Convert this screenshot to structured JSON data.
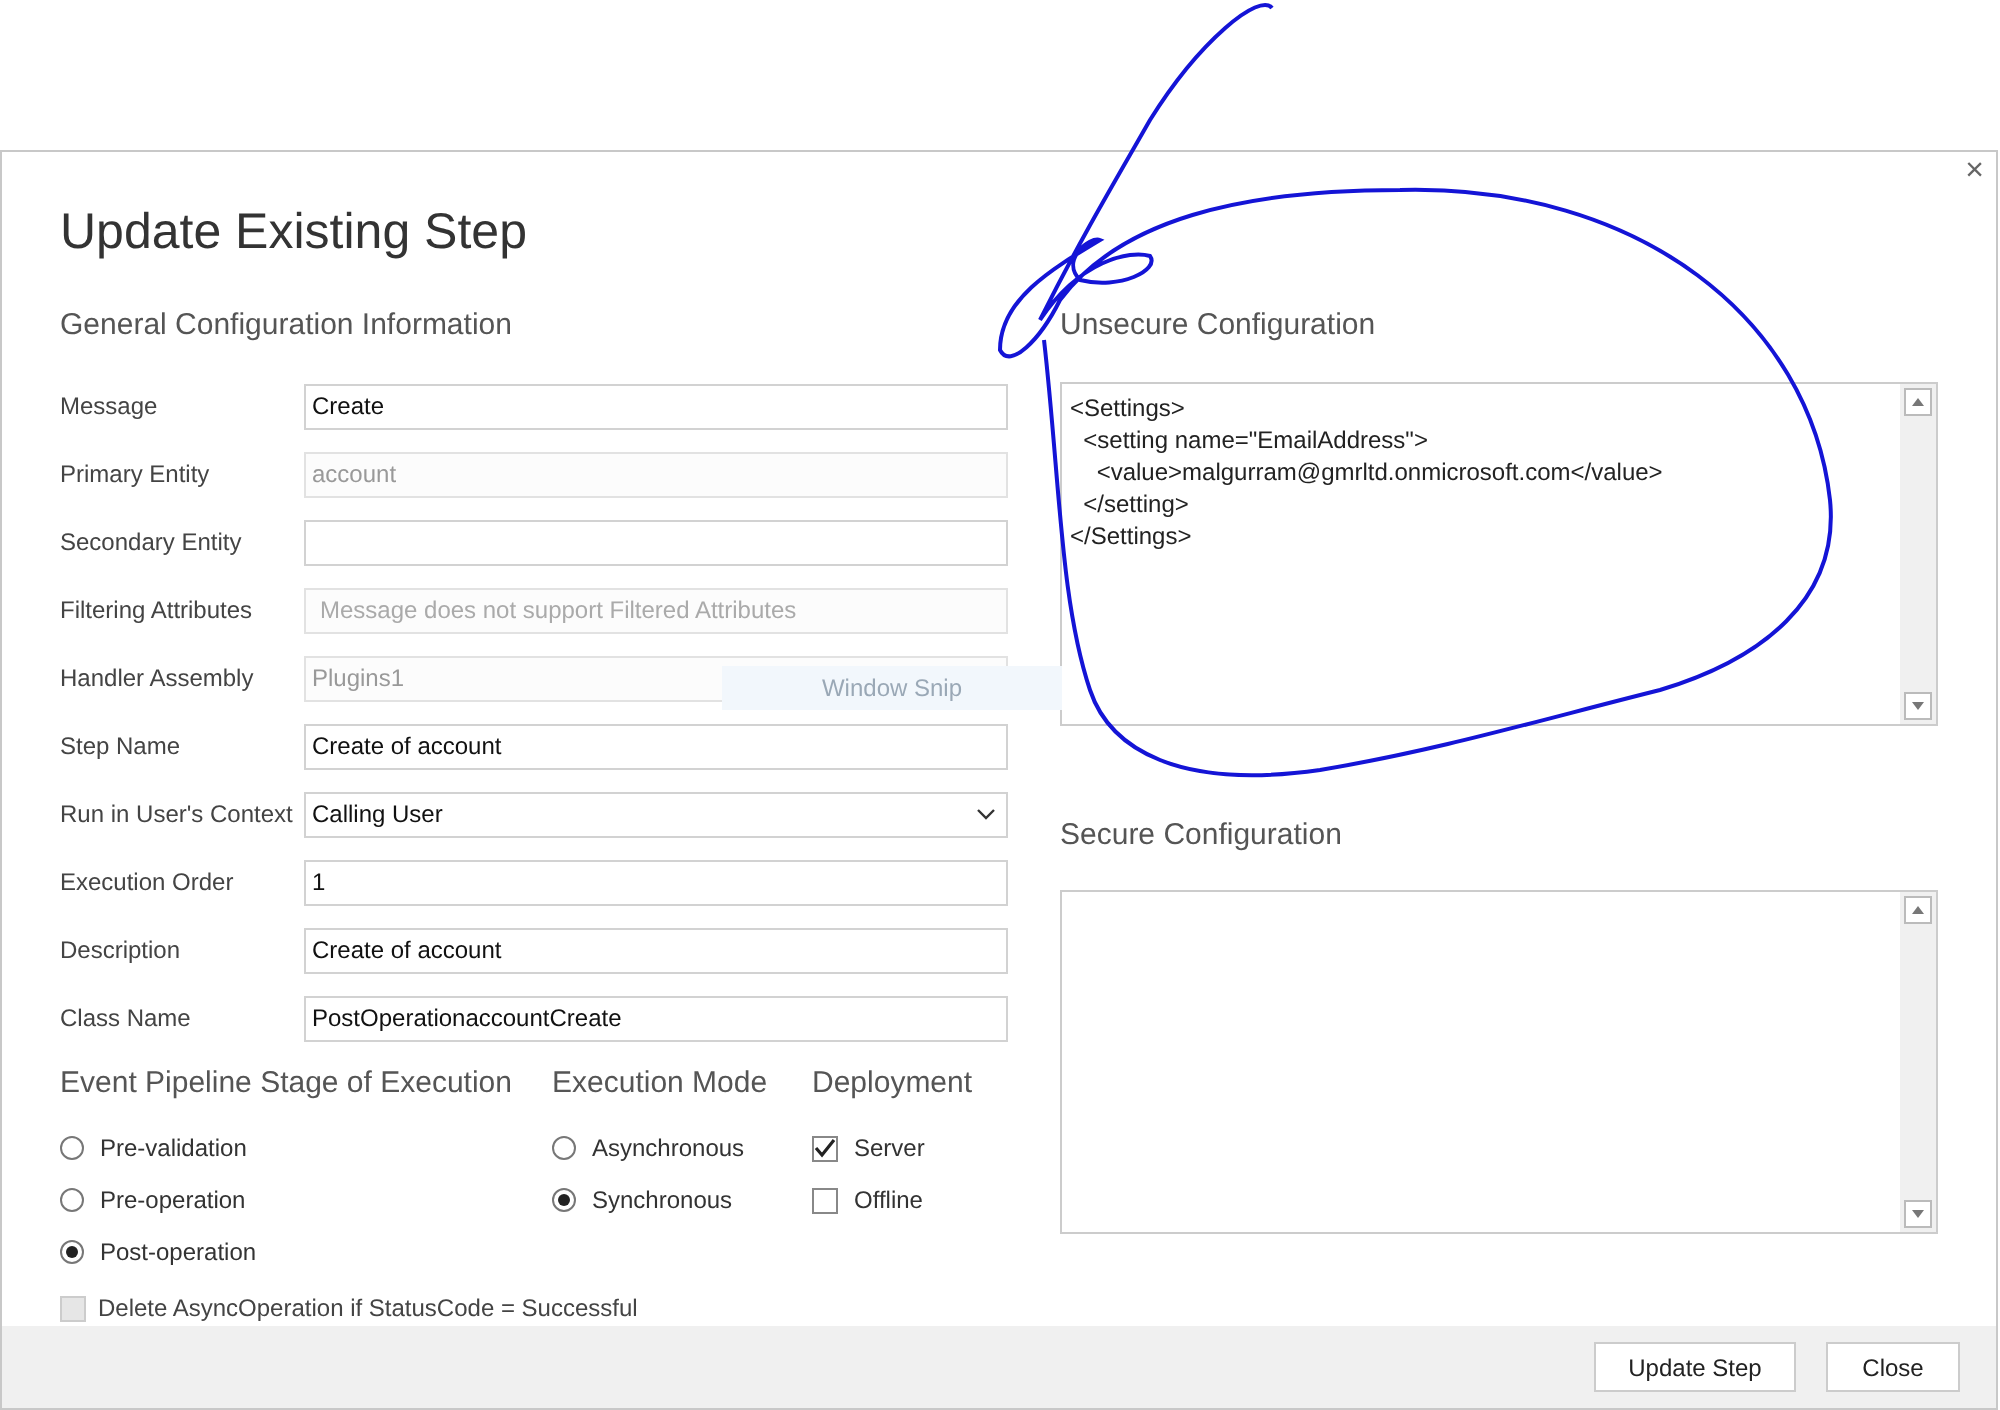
{
  "dialog": {
    "title": "Update Existing Step",
    "close_glyph": "×"
  },
  "general": {
    "heading": "General Configuration Information",
    "fields": [
      {
        "label": "Message",
        "kind": "input",
        "value": "Create",
        "disabled": false
      },
      {
        "label": "Primary Entity",
        "kind": "input",
        "value": "account",
        "disabled": true
      },
      {
        "label": "Secondary Entity",
        "kind": "input",
        "disabled": false
      },
      {
        "label": "Filtering Attributes",
        "kind": "input",
        "placeholder": "Message does not support Filtered Attributes",
        "disabled": true
      },
      {
        "label": "Handler Assembly",
        "kind": "select",
        "value": "Plugins1",
        "disabled": true
      },
      {
        "label": "Step Name",
        "kind": "input",
        "value": "Create of account",
        "disabled": false
      },
      {
        "label": "Run in User's Context",
        "kind": "select",
        "value": "Calling User",
        "disabled": false
      },
      {
        "label": "Execution Order",
        "kind": "input",
        "value": "1",
        "disabled": false
      },
      {
        "label": "Description",
        "kind": "input",
        "value": "Create of account",
        "disabled": false
      },
      {
        "label": "Class Name",
        "kind": "input",
        "value": "PostOperationaccountCreate",
        "disabled": false
      }
    ]
  },
  "pipeline": {
    "heading": "Event Pipeline Stage of Execution",
    "options": [
      {
        "label": "Pre-validation",
        "selected": false
      },
      {
        "label": "Pre-operation",
        "selected": false
      },
      {
        "label": "Post-operation",
        "selected": true
      }
    ]
  },
  "execution_mode": {
    "heading": "Execution Mode",
    "options": [
      {
        "label": "Asynchronous",
        "selected": false
      },
      {
        "label": "Synchronous",
        "selected": true
      }
    ]
  },
  "deployment": {
    "heading": "Deployment",
    "options": [
      {
        "label": "Server",
        "checked": true
      },
      {
        "label": "Offline",
        "checked": false
      }
    ]
  },
  "delete_async": {
    "label": "Delete AsyncOperation if StatusCode = Successful",
    "checked": false,
    "disabled": true
  },
  "unsecure": {
    "heading": "Unsecure  Configuration",
    "lines": [
      "<Settings>",
      "  <setting name=\"EmailAddress\">",
      "    <value>malgurram@gmrltd.onmicrosoft.com</value>",
      "  </setting>",
      "</Settings>"
    ]
  },
  "secure": {
    "heading": "Secure  Configuration"
  },
  "overlay_label": "Window Snip",
  "buttons": [
    "Update Step",
    "Close"
  ]
}
